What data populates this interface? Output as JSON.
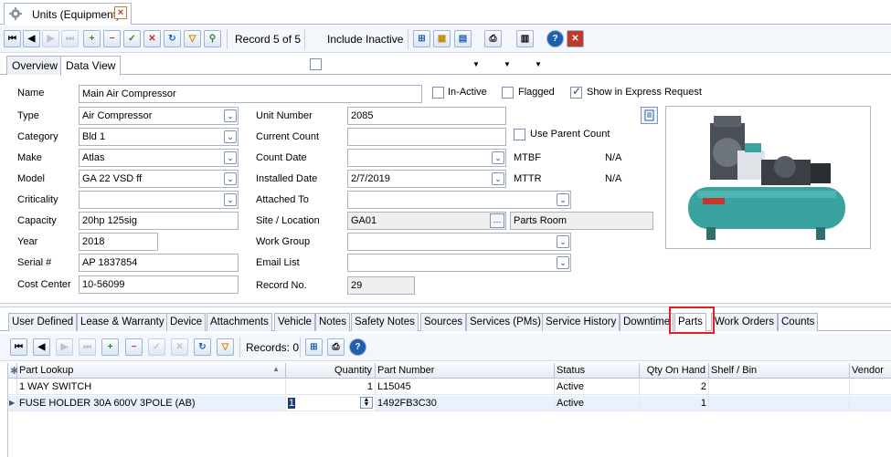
{
  "doc_tab": {
    "title": "Units (Equipment)"
  },
  "toolbar": {
    "record_text": "Record 5 of 5",
    "include_inactive_label": "Include Inactive"
  },
  "view_tabs": [
    "Overview",
    "Data View"
  ],
  "form": {
    "name": {
      "label": "Name",
      "value": "Main Air Compressor"
    },
    "type": {
      "label": "Type",
      "value": "Air Compressor"
    },
    "category": {
      "label": "Category",
      "value": "Bld 1"
    },
    "make": {
      "label": "Make",
      "value": "Atlas"
    },
    "model": {
      "label": "Model",
      "value": "GA 22 VSD ff"
    },
    "criticality": {
      "label": "Criticality",
      "value": ""
    },
    "capacity": {
      "label": "Capacity",
      "value": "20hp 125sig"
    },
    "year": {
      "label": "Year",
      "value": "2018"
    },
    "serial": {
      "label": "Serial #",
      "value": "AP 1837854"
    },
    "cost_center": {
      "label": "Cost Center",
      "value": "10-56099"
    },
    "unit_number": {
      "label": "Unit Number",
      "value": "2085"
    },
    "current_count": {
      "label": "Current Count",
      "value": ""
    },
    "count_date": {
      "label": "Count Date",
      "value": ""
    },
    "installed_date": {
      "label": "Installed Date",
      "value": "2/7/2019"
    },
    "attached_to": {
      "label": "Attached To",
      "value": ""
    },
    "site_location": {
      "label": "Site / Location",
      "value": "GA01",
      "location": "Parts Room"
    },
    "work_group": {
      "label": "Work Group",
      "value": ""
    },
    "email_list": {
      "label": "Email List",
      "value": ""
    },
    "record_no": {
      "label": "Record No.",
      "value": "29"
    },
    "in_active": {
      "label": "In-Active",
      "checked": false
    },
    "flagged": {
      "label": "Flagged",
      "checked": false
    },
    "show_express": {
      "label": "Show in Express Request",
      "checked": true
    },
    "use_parent_count": {
      "label": "Use Parent Count",
      "checked": false
    },
    "mtbf": {
      "label": "MTBF",
      "value": "N/A"
    },
    "mttr": {
      "label": "MTTR",
      "value": "N/A"
    }
  },
  "sub_tabs": [
    "User Defined",
    "Lease & Warranty",
    "Device",
    "Attachments",
    "Vehicle",
    "Notes",
    "Safety Notes",
    "Sources",
    "Services (PMs)",
    "Service History",
    "Downtime",
    "Parts",
    "Work Orders",
    "Counts"
  ],
  "active_sub_tab": "Parts",
  "grid_toolbar": {
    "records_text": "Records: 0"
  },
  "grid": {
    "columns": [
      "Part Lookup",
      "Quantity",
      "Part Number",
      "Status",
      "Qty On Hand",
      "Shelf / Bin",
      "Vendor"
    ],
    "rows": [
      [
        "1 WAY SWITCH",
        "1",
        "L15045",
        "Active",
        "2",
        "",
        ""
      ],
      [
        "FUSE HOLDER 30A 600V 3POLE (AB)",
        "1",
        "1492FB3C30",
        "Active",
        "1",
        "",
        ""
      ]
    ]
  },
  "colors": {
    "accent": "#1f5fae",
    "highlight": "#e0201e",
    "compressor_teal": "#3aa3a0"
  }
}
